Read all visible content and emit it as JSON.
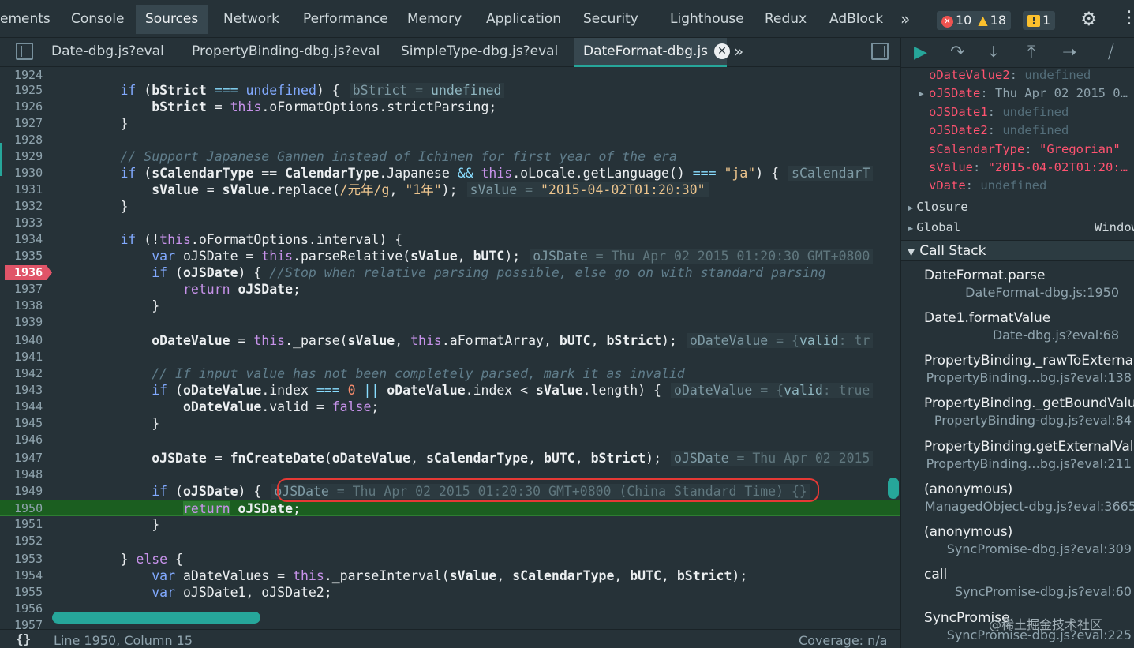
{
  "panel_tabs": [
    {
      "label": "ements"
    },
    {
      "label": "Console"
    },
    {
      "label": "Sources"
    },
    {
      "label": "Network"
    },
    {
      "label": "Performance"
    },
    {
      "label": "Memory"
    },
    {
      "label": "Application"
    },
    {
      "label": "Security"
    },
    {
      "label": "Lighthouse"
    },
    {
      "label": "Redux"
    },
    {
      "label": "AdBlock"
    }
  ],
  "active_panel": "Sources",
  "more_tabs_glyph": "»",
  "counts": {
    "errors": "10",
    "warnings": "18",
    "issues": "1"
  },
  "file_tabs": [
    {
      "label": "Date-dbg.js?eval"
    },
    {
      "label": "PropertyBinding-dbg.js?eval"
    },
    {
      "label": "SimpleType-dbg.js?eval"
    },
    {
      "label": "DateFormat-dbg.js"
    }
  ],
  "active_file": "DateFormat-dbg.js",
  "code_lines": [
    {
      "n": "1924"
    },
    {
      "n": "1925"
    },
    {
      "n": "1926"
    },
    {
      "n": "1927"
    },
    {
      "n": "1928"
    },
    {
      "n": "1929"
    },
    {
      "n": "1930"
    },
    {
      "n": "1931"
    },
    {
      "n": "1932"
    },
    {
      "n": "1933"
    },
    {
      "n": "1934"
    },
    {
      "n": "1935"
    },
    {
      "n": "1936"
    },
    {
      "n": "1937"
    },
    {
      "n": "1938"
    },
    {
      "n": "1939"
    },
    {
      "n": "1940"
    },
    {
      "n": "1941"
    },
    {
      "n": "1942"
    },
    {
      "n": "1943"
    },
    {
      "n": "1944"
    },
    {
      "n": "1945"
    },
    {
      "n": "1946"
    },
    {
      "n": "1947"
    },
    {
      "n": "1948"
    },
    {
      "n": "1949"
    },
    {
      "n": "1950"
    },
    {
      "n": "1951"
    },
    {
      "n": "1952"
    },
    {
      "n": "1953"
    },
    {
      "n": "1954"
    },
    {
      "n": "1955"
    },
    {
      "n": "1956"
    },
    {
      "n": "1957"
    }
  ],
  "breakpoint_line": "1936",
  "paused_line": "1950",
  "status": {
    "braces": "{}",
    "cursor": "Line 1950, Column 15",
    "coverage": "Coverage: n/a"
  },
  "scope": {
    "vars": [
      {
        "name": "oDateValue2",
        "value": "undefined"
      },
      {
        "name": "oJSDate",
        "value": "Thu Apr 02 2015 0…"
      },
      {
        "name": "oJSDate1",
        "value": "undefined"
      },
      {
        "name": "oJSDate2",
        "value": "undefined"
      },
      {
        "name": "sCalendarType",
        "value": "\"Gregorian\""
      },
      {
        "name": "sValue",
        "value": "\"2015-04-02T01:20:…"
      },
      {
        "name": "vDate",
        "value": "undefined"
      }
    ],
    "closure_label": "Closure",
    "global_label": "Global",
    "global_value": "Window"
  },
  "call_stack": {
    "header": "Call Stack",
    "frames": [
      {
        "fn": "DateFormat.parse",
        "loc": "DateFormat-dbg.js:1950"
      },
      {
        "fn": "Date1.formatValue",
        "loc": "Date-dbg.js?eval:68"
      },
      {
        "fn": "PropertyBinding._rawToExternal",
        "loc": "PropertyBinding…bg.js?eval:138"
      },
      {
        "fn": "PropertyBinding._getBoundValue",
        "loc": "PropertyBinding-dbg.js?eval:84"
      },
      {
        "fn": "PropertyBinding.getExternalVal…",
        "loc": "PropertyBinding…bg.js?eval:211"
      },
      {
        "fn": "(anonymous)",
        "loc": "ManagedObject-dbg.js?eval:3665"
      },
      {
        "fn": "(anonymous)",
        "loc": "SyncPromise-dbg.js?eval:309"
      },
      {
        "fn": "call",
        "loc": "SyncPromise-dbg.js?eval:60"
      },
      {
        "fn": "SyncPromise",
        "loc": "SyncPromise-dbg.js?eval:225"
      }
    ]
  },
  "watermark": "@稀土掘金技术社区",
  "icons": {
    "toggle_navigator": "sidebar-toggle-icon",
    "resume": "resume-icon",
    "step_over": "step-over-icon",
    "step_into": "step-into-icon",
    "step_out": "step-out-icon",
    "step": "step-icon",
    "deactivate_breakpoints": "deactivate-breakpoints-icon",
    "settings": "gear-icon",
    "more": "kebab-icon"
  },
  "colors": {
    "accent": "#26a69a",
    "breakpoint": "#e05468",
    "paused_line": "#1b5e20",
    "annotation_circle": "#e53935"
  }
}
